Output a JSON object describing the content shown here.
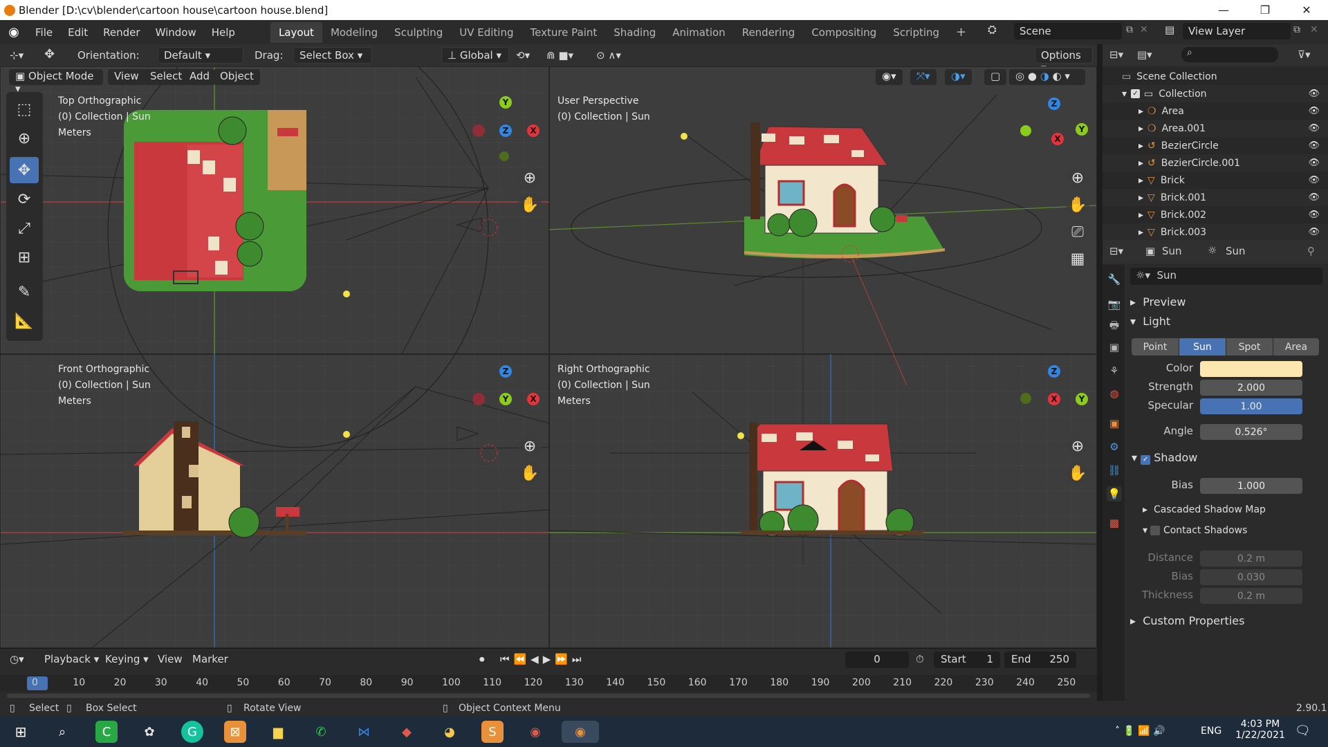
{
  "window": {
    "title": "Blender [D:\\cv\\blender\\cartoon house\\cartoon house.blend]",
    "minimize": "—",
    "maximize": "❐",
    "close": "✕"
  },
  "menu": [
    "File",
    "Edit",
    "Render",
    "Window",
    "Help"
  ],
  "workspaces": [
    "Layout",
    "Modeling",
    "Sculpting",
    "UV Editing",
    "Texture Paint",
    "Shading",
    "Animation",
    "Rendering",
    "Compositing",
    "Scripting"
  ],
  "workspace_add": "+",
  "scene": {
    "label": "Scene",
    "view_layer": "View Layer"
  },
  "tool_header": {
    "orientation_label": "Orientation:",
    "orientation_value": "Default",
    "drag_label": "Drag:",
    "drag_value": "Select Box",
    "transform_orientation": "Global",
    "options": "Options"
  },
  "viewport_header": {
    "mode": "Object Mode",
    "view": "View",
    "select": "Select",
    "add": "Add",
    "object": "Object"
  },
  "viewports": [
    {
      "view": "Top Orthographic",
      "collection": "(0) Collection | Sun",
      "units": "Meters"
    },
    {
      "view": "User Perspective",
      "collection": "(0) Collection | Sun",
      "units": ""
    },
    {
      "view": "Front Orthographic",
      "collection": "(0) Collection | Sun",
      "units": "Meters"
    },
    {
      "view": "Right Orthographic",
      "collection": "(0) Collection | Sun",
      "units": "Meters"
    }
  ],
  "gizmo_axes": {
    "x": "X",
    "y": "Y",
    "z": "Z"
  },
  "colors": {
    "accent": "#4772b3",
    "x_axis": "#e8313b",
    "y_axis": "#8ccc1a",
    "z_axis": "#2f86e3",
    "sun_color": "#fde7b0",
    "roof": "#c9383c",
    "grass": "#4a9b38"
  },
  "timeline": {
    "menus": [
      "Playback",
      "Keying",
      "View",
      "Marker"
    ],
    "current_frame": "0",
    "start_label": "Start",
    "start": "1",
    "end_label": "End",
    "end": "250",
    "ticks": [
      "0",
      "10",
      "20",
      "30",
      "40",
      "50",
      "60",
      "70",
      "80",
      "90",
      "100",
      "110",
      "120",
      "130",
      "140",
      "150",
      "160",
      "170",
      "180",
      "190",
      "200",
      "210",
      "220",
      "230",
      "240",
      "250"
    ]
  },
  "statusbar": {
    "select": "Select",
    "box_select": "Box Select",
    "rotate_view": "Rotate View",
    "context_menu": "Object Context Menu",
    "version": "2.90.1"
  },
  "outliner": {
    "scene_collection": "Scene Collection",
    "collection": "Collection",
    "items": [
      "Area",
      "Area.001",
      "BezierCircle",
      "BezierCircle.001",
      "Brick",
      "Brick.001",
      "Brick.002",
      "Brick.003"
    ]
  },
  "properties": {
    "object_name": "Sun",
    "data_name": "Sun",
    "light_name": "Sun",
    "preview": "Preview",
    "light": "Light",
    "types": [
      "Point",
      "Sun",
      "Spot",
      "Area"
    ],
    "active_type": "Sun",
    "color_label": "Color",
    "strength_label": "Strength",
    "strength": "2.000",
    "specular_label": "Specular",
    "specular": "1.00",
    "angle_label": "Angle",
    "angle": "0.526°",
    "shadow": "Shadow",
    "bias_label": "Bias",
    "bias": "1.000",
    "cascaded": "Cascaded Shadow Map",
    "contact": "Contact Shadows",
    "distance_label": "Distance",
    "distance": "0.2 m",
    "cbias_label": "Bias",
    "cbias": "0.030",
    "thickness_label": "Thickness",
    "thickness": "0.2 m",
    "custom": "Custom Properties"
  },
  "taskbar": {
    "lang": "ENG",
    "time": "4:03 PM",
    "date": "1/22/2021"
  }
}
